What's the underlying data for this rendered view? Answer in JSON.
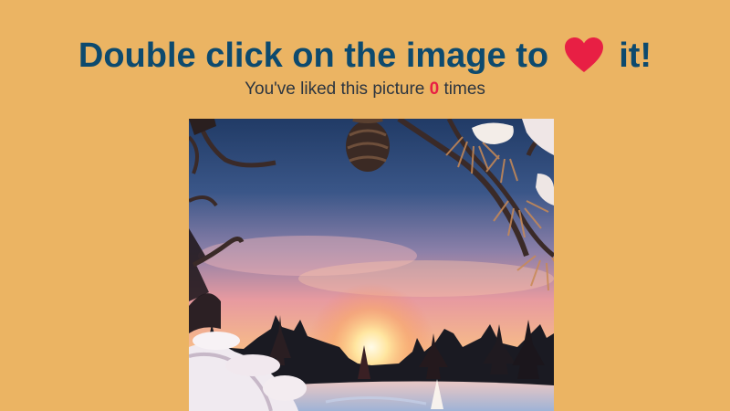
{
  "header": {
    "title_before": "Double click on the image to",
    "title_after": "it!",
    "heart_icon": "heart-icon",
    "heart_color": "#e81f44",
    "title_color": "#0d4a6e"
  },
  "likes": {
    "text_before": "You've liked this picture",
    "count": "0",
    "text_after": "times",
    "count_color": "#e81f44"
  },
  "photo": {
    "subject": "winter sunset through snowy pine branches"
  },
  "colors": {
    "background": "#ebb463"
  }
}
